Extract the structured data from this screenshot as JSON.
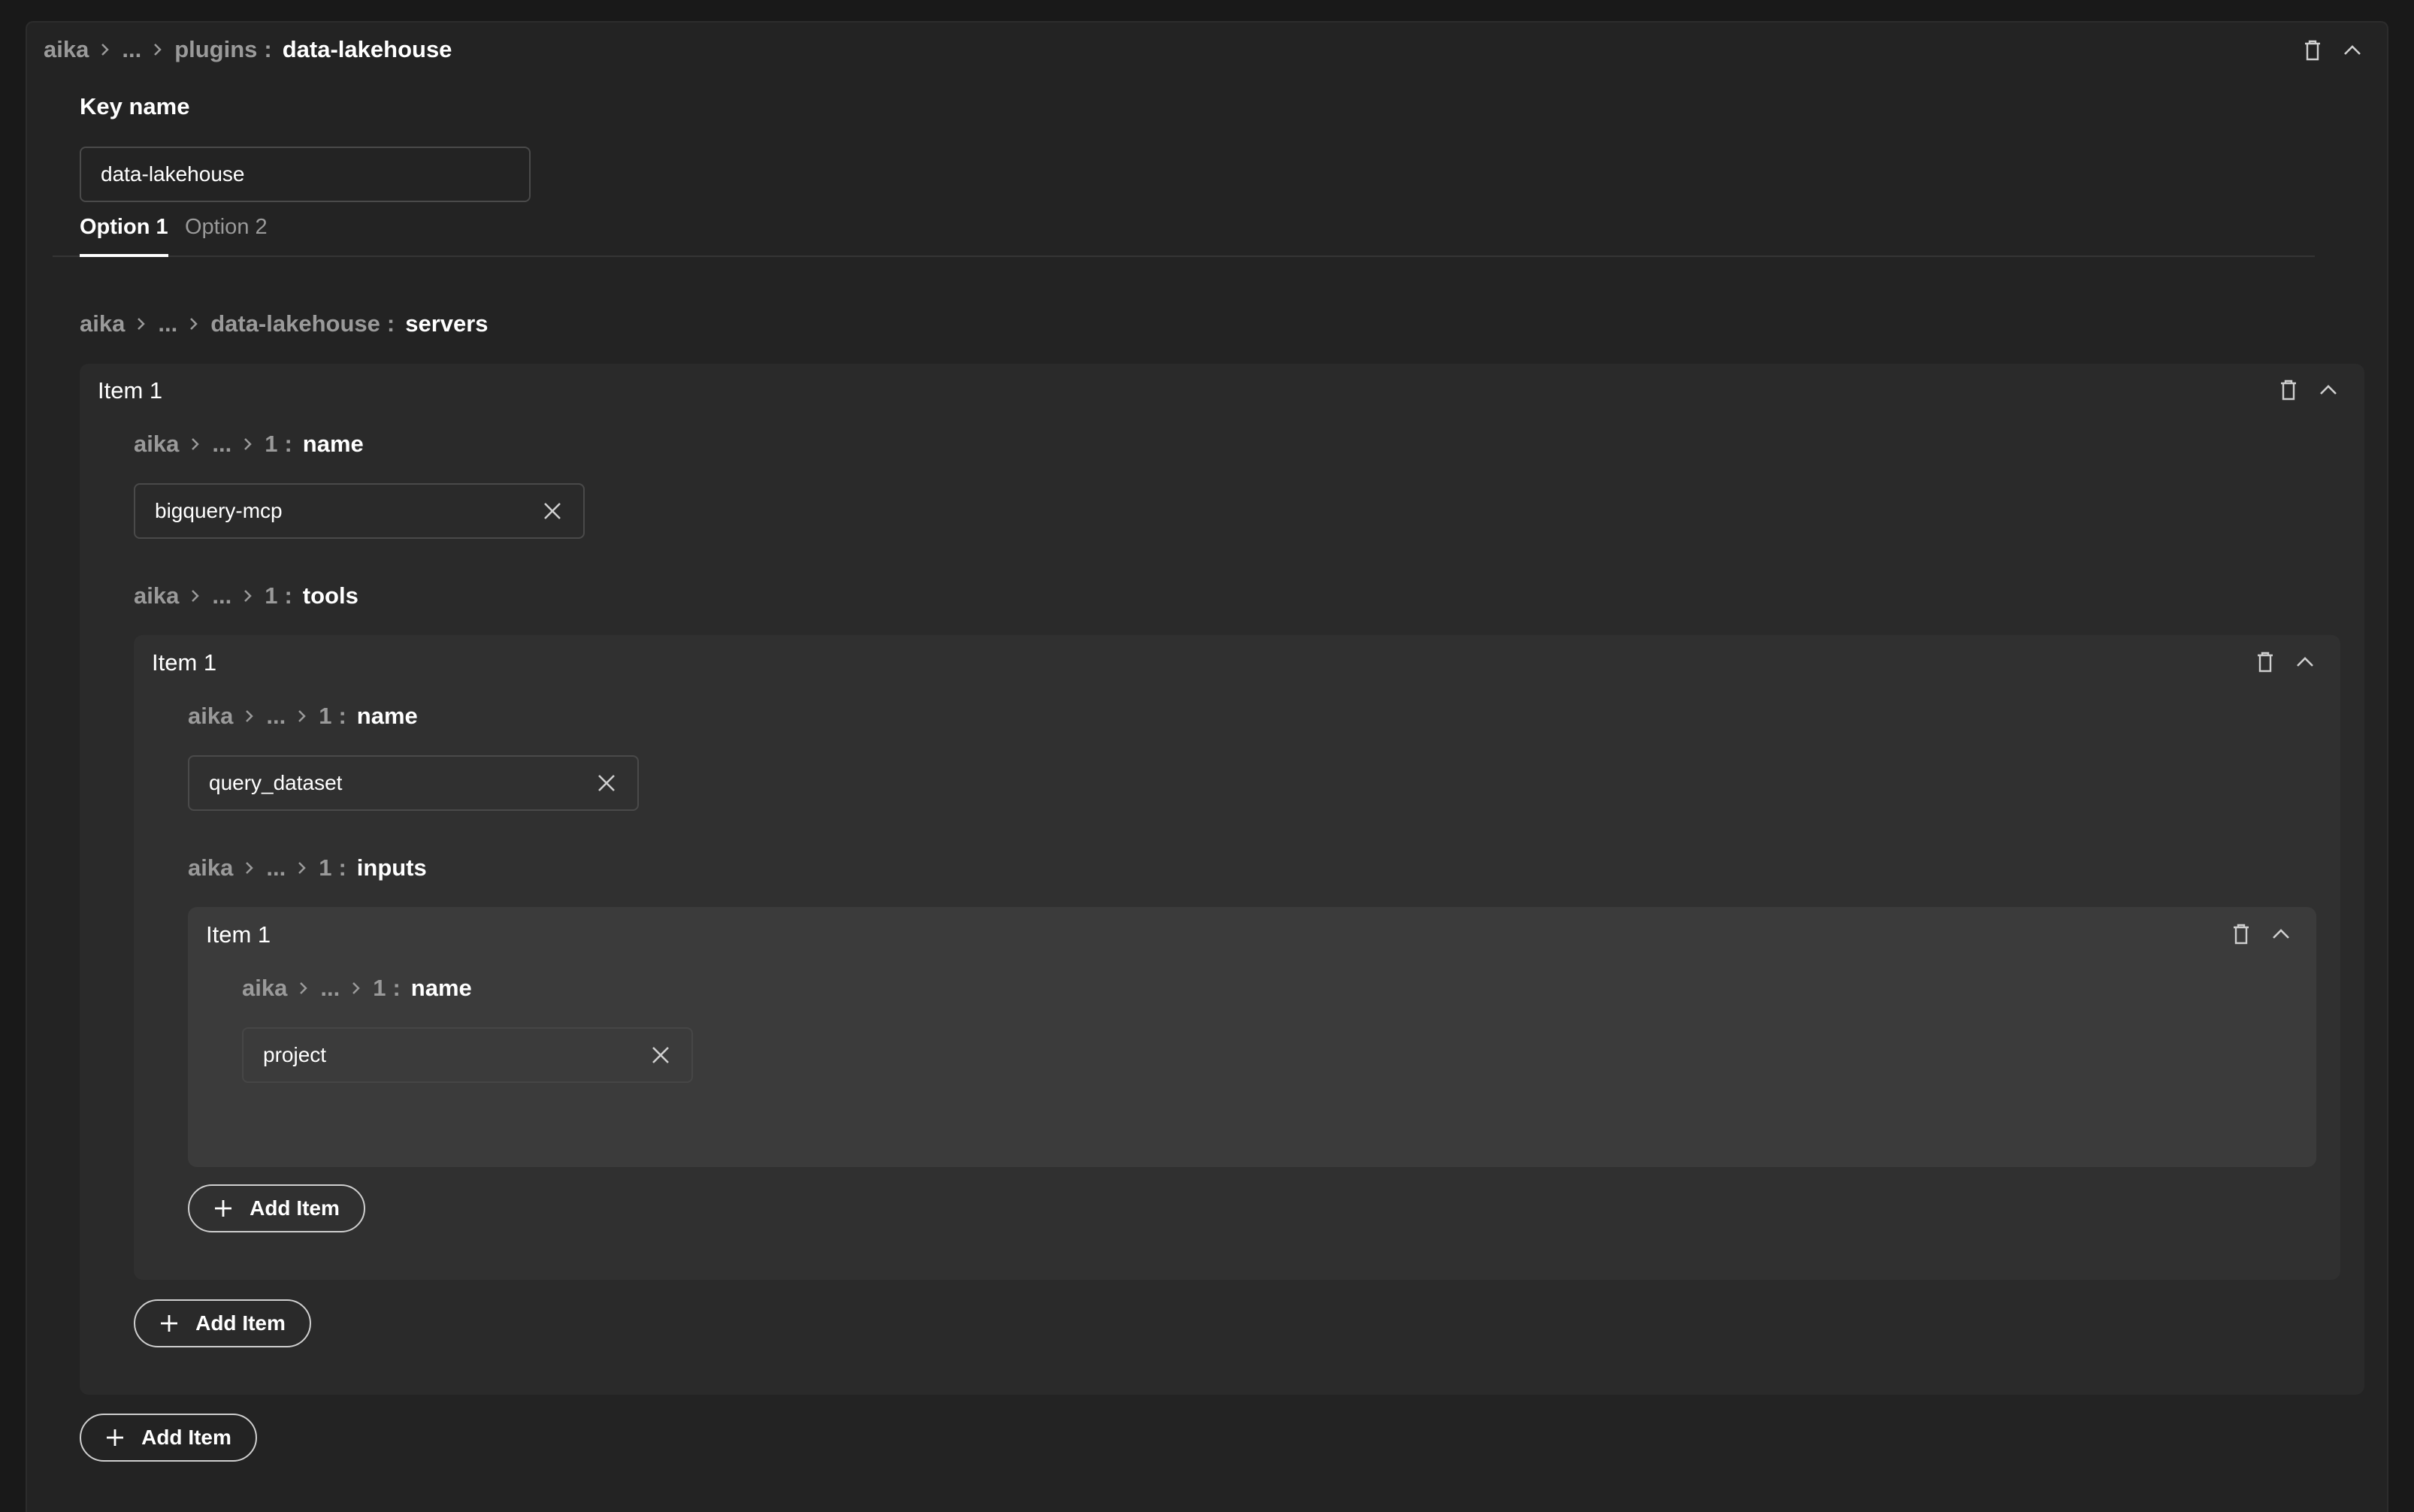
{
  "header": {
    "breadcrumb": [
      "aika",
      "...",
      "plugins"
    ],
    "current": "data-lakehouse"
  },
  "key_name": {
    "label": "Key name",
    "value": "data-lakehouse"
  },
  "tabs": [
    {
      "label": "Option 1",
      "active": true
    },
    {
      "label": "Option 2",
      "active": false
    }
  ],
  "servers": {
    "breadcrumb": [
      "aika",
      "...",
      "data-lakehouse"
    ],
    "current": "servers",
    "item": {
      "title": "Item 1",
      "name_breadcrumb": [
        "aika",
        "...",
        "1"
      ],
      "name_current": "name",
      "name_value": "bigquery-mcp",
      "tools_breadcrumb": [
        "aika",
        "...",
        "1"
      ],
      "tools_current": "tools",
      "tool": {
        "title": "Item 1",
        "name_breadcrumb": [
          "aika",
          "...",
          "1"
        ],
        "name_current": "name",
        "name_value": "query_dataset",
        "inputs_breadcrumb": [
          "aika",
          "...",
          "1"
        ],
        "inputs_current": "inputs",
        "input": {
          "title": "Item 1",
          "name_breadcrumb": [
            "aika",
            "...",
            "1"
          ],
          "name_current": "name",
          "name_value": "project"
        },
        "add_label": "Add Item"
      },
      "add_label": "Add Item"
    },
    "add_label": "Add Item"
  },
  "icons": {
    "delete": "trash-icon",
    "collapse": "chevron-up-icon",
    "clear": "close-icon",
    "add": "plus-icon",
    "separator": "chevron-right-icon"
  },
  "colors": {
    "background": "#191919",
    "panel": "#232323",
    "card_level_1": "#2a2a2a",
    "card_level_2": "#303030",
    "card_level_3": "#3b3b3b",
    "text": "#ffffff",
    "muted_text": "#9a9a9a"
  }
}
